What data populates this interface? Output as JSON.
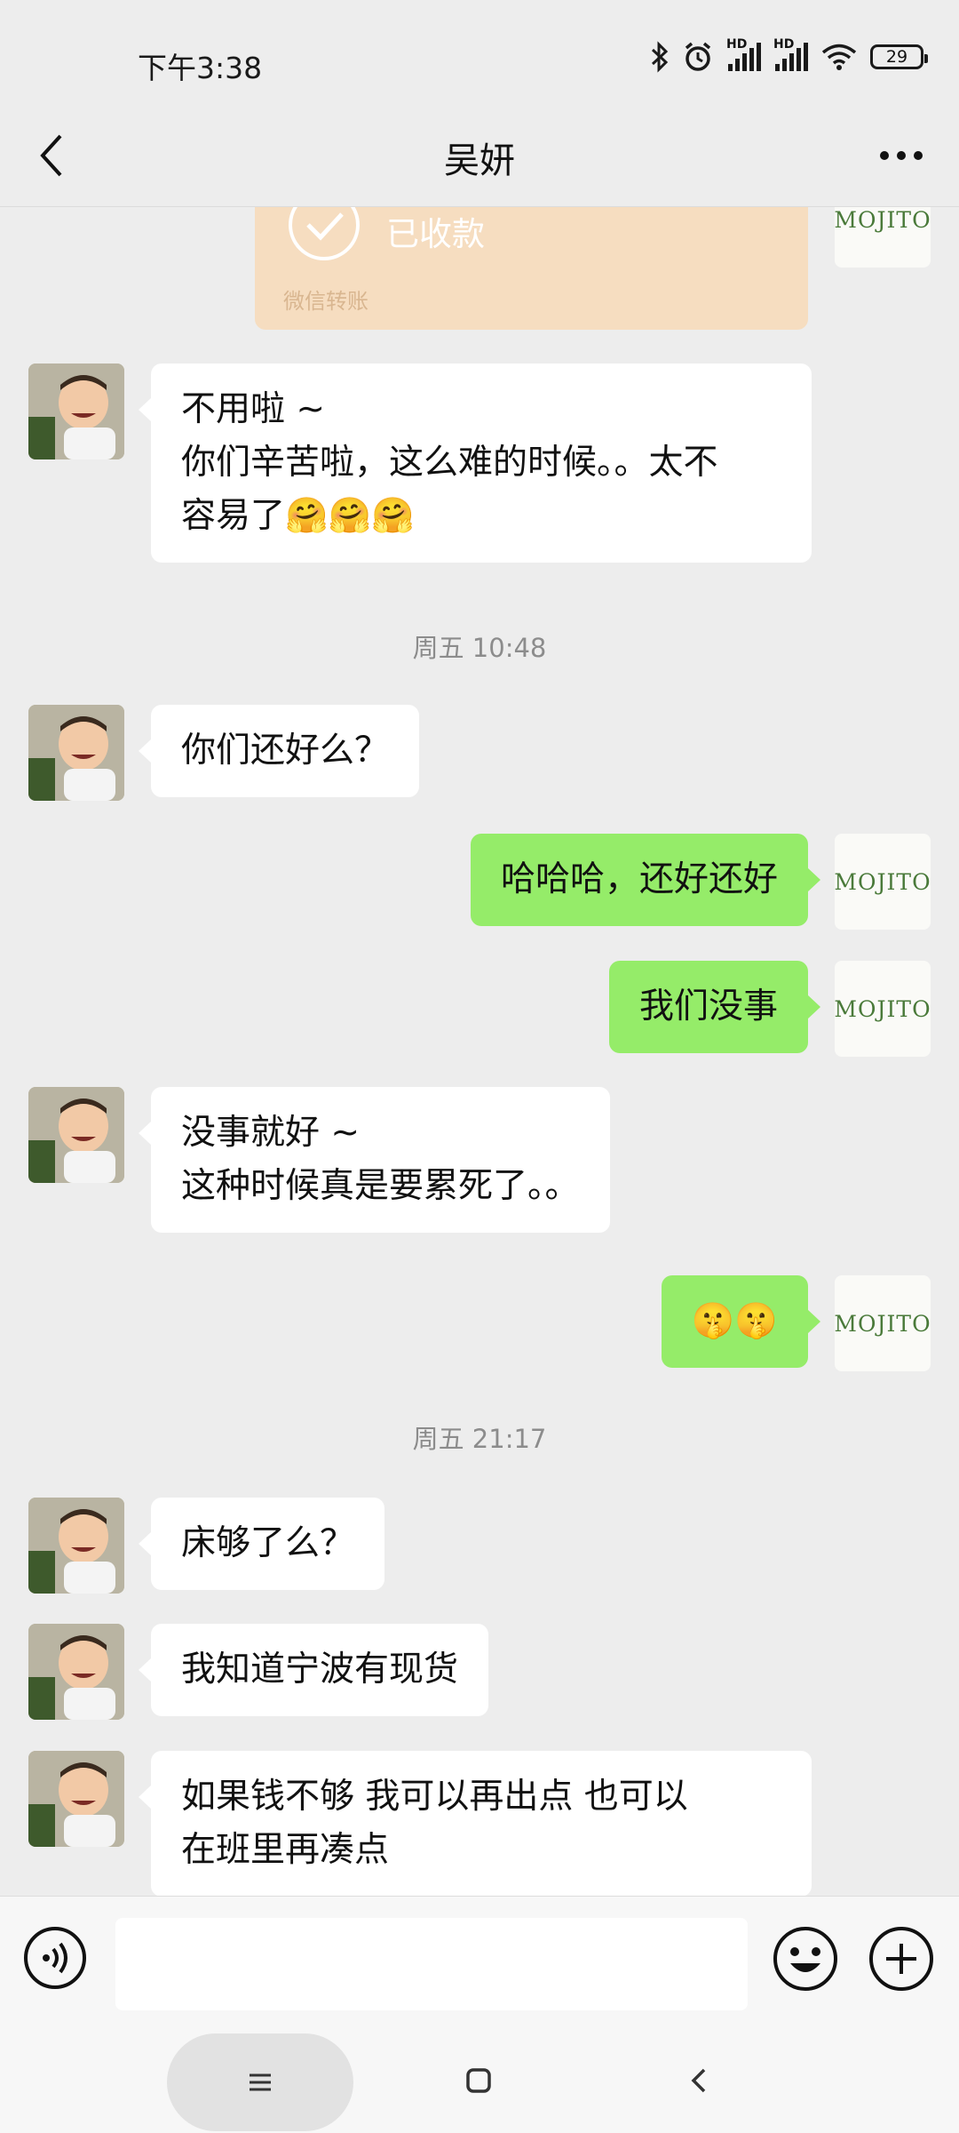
{
  "status_bar": {
    "time": "下午3:38",
    "battery": "29",
    "signal_label": "HD"
  },
  "header": {
    "title": "吴妍"
  },
  "transfer": {
    "status": "已收款",
    "label": "微信转账"
  },
  "messages": [
    {
      "side": "left",
      "lines": [
        "不用啦 ~",
        "你们辛苦啦，这么难的时候。。太不",
        "容易了"
      ],
      "emoji": "🤗🤗🤗"
    },
    {
      "type": "time",
      "text": "周五 10:48"
    },
    {
      "side": "left",
      "text": "你们还好么？"
    },
    {
      "side": "right",
      "text": "哈哈哈，还好还好"
    },
    {
      "side": "right",
      "text": "我们没事"
    },
    {
      "side": "left",
      "lines": [
        "没事就好 ~",
        "这种时候真是要累死了。。"
      ]
    },
    {
      "side": "right",
      "emoji": "🤫🤫"
    },
    {
      "type": "time",
      "text": "周五 21:17"
    },
    {
      "side": "left",
      "text": "床够了么？"
    },
    {
      "side": "left",
      "text": "我知道宁波有现货"
    },
    {
      "side": "left",
      "lines": [
        "如果钱不够  我可以再出点 也可以",
        "在班里再凑点"
      ]
    }
  ],
  "my_avatar_text": "MOJITO",
  "input": {
    "value": "",
    "placeholder": ""
  },
  "colors": {
    "background": "#ededed",
    "my_bubble": "#95ec69",
    "their_bubble": "#ffffff",
    "transfer_card": "#f6ddc0"
  },
  "icons": {
    "back": "chevron-left-icon",
    "more": "more-dots-icon",
    "voice": "voice-icon",
    "emoji": "emoji-icon",
    "plus": "plus-icon",
    "check": "check-circle-icon",
    "nav_menu": "menu-icon",
    "nav_home": "home-square-icon",
    "nav_back": "nav-back-icon"
  }
}
